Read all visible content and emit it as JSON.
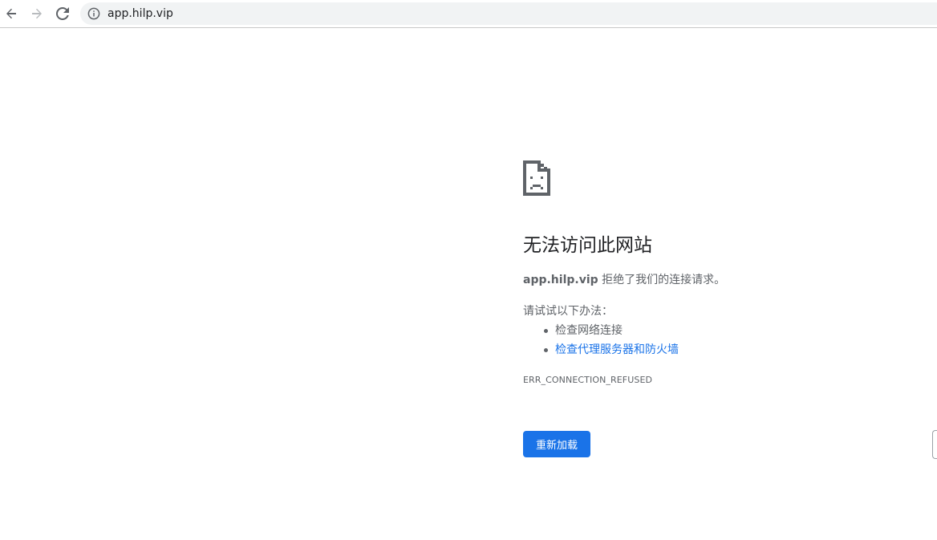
{
  "browser": {
    "url": "app.hilp.vip",
    "icons": {
      "back": "back-arrow-icon",
      "forward": "forward-arrow-icon",
      "reload": "reload-icon",
      "site_info": "info-icon"
    }
  },
  "error_page": {
    "icon": "sad-page-icon",
    "title": "无法访问此网站",
    "host": "app.hilp.vip",
    "summary_suffix": " 拒绝了我们的连接请求。",
    "suggestions_label": "请试试以下办法：",
    "suggestions": [
      {
        "label": "检查网络连接",
        "is_link": false
      },
      {
        "label": "检查代理服务器和防火墙",
        "is_link": true
      }
    ],
    "error_code": "ERR_CONNECTION_REFUSED",
    "reload_label": "重新加载"
  },
  "colors": {
    "accent": "#1a73e8",
    "text_primary": "#202124",
    "text_secondary": "#5f6368",
    "omnibox_bg": "#f1f3f4"
  }
}
